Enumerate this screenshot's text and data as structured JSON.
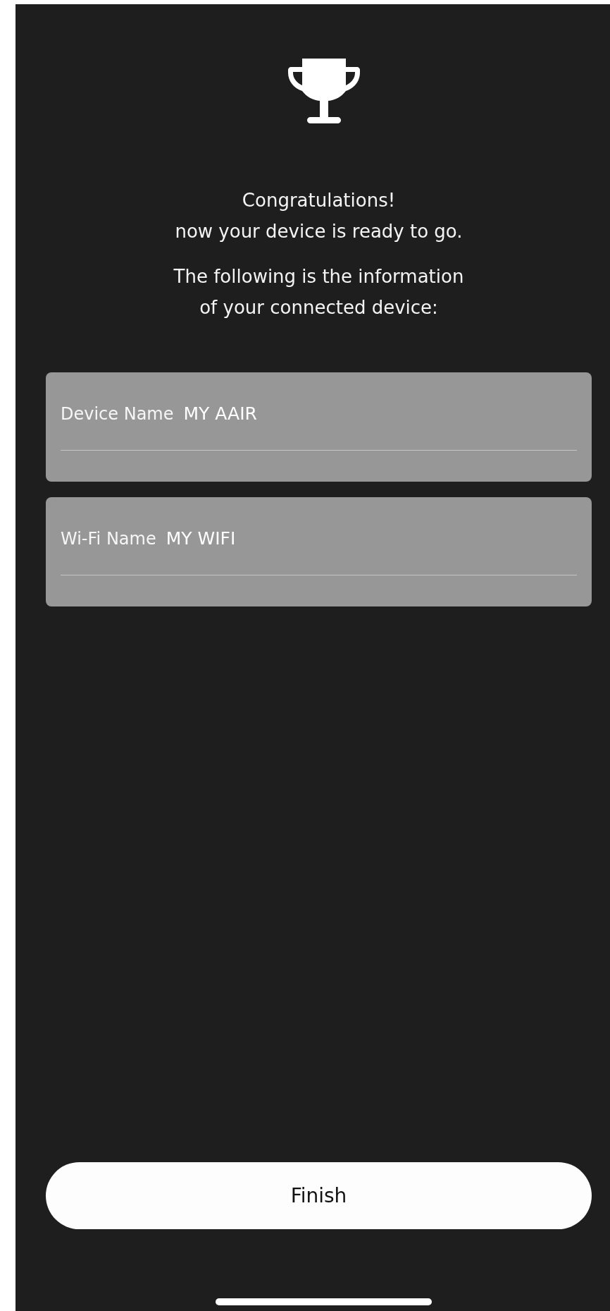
{
  "heading": "Congratulations!\nnow your device is ready to go.",
  "message": "The following is the information\nof your connected device:",
  "fields": [
    {
      "label": "Device Name",
      "value": "MY AAIR"
    },
    {
      "label": "Wi-Fi Name",
      "value": "MY WIFI"
    }
  ],
  "button": "Finish"
}
